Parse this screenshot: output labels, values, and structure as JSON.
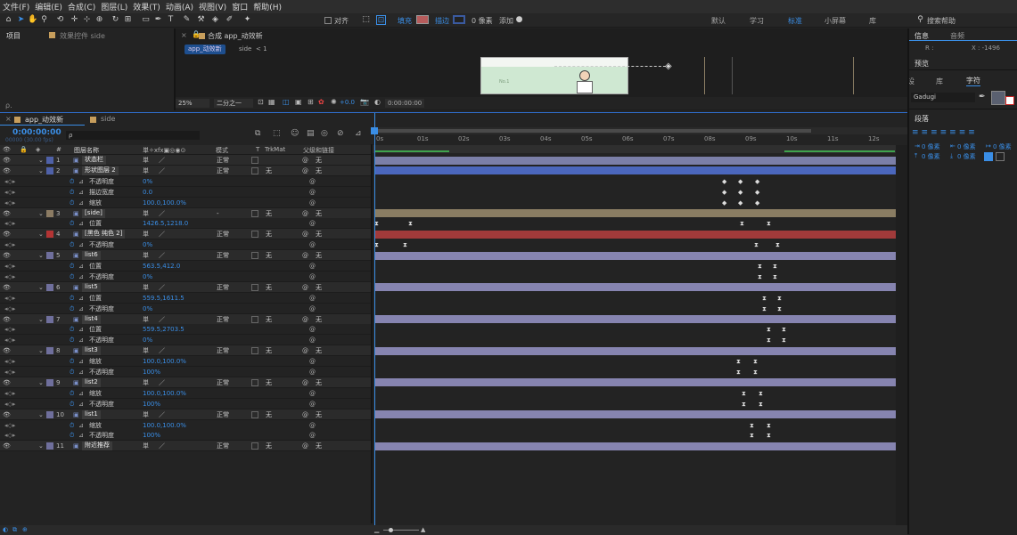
{
  "menu": [
    "文件(F)",
    "编辑(E)",
    "合成(C)",
    "图层(L)",
    "效果(T)",
    "动画(A)",
    "视图(V)",
    "窗口",
    "帮助(H)"
  ],
  "toolbar": {
    "align_label": "对齐",
    "fill_label": "填充",
    "stroke_label": "描边",
    "stroke_px": "0 像素",
    "add_label": "添加",
    "workspaces": [
      "默认",
      "学习",
      "标准",
      "小屏幕",
      "库"
    ],
    "active_workspace": "标准",
    "search_help": "搜索帮助"
  },
  "project": {
    "tab": "项目",
    "effects_tab": "效果控件 side"
  },
  "comp_viewer": {
    "tab": "合成 app_动效新",
    "crumb1": "app_动效新",
    "crumb2": "side",
    "crumb_sep": "< 1",
    "zoom": "25%",
    "resolution": "二分之一",
    "exposure": "+0.0",
    "timecode": "0:00:00:00"
  },
  "right_panel": {
    "info_tab": "信息",
    "audio_tab": "音频",
    "r_label": "R :",
    "x_label": "X : -1496",
    "preview_tab": "预览",
    "effects_tab": "设",
    "library_tab": "库",
    "character_tab": "字符",
    "font": "Gadugi",
    "paragraph_tab": "段落",
    "px_values": [
      "0 像素",
      "0 像素",
      "0 像素",
      "0 像素",
      "0 像素"
    ]
  },
  "timeline": {
    "tabs": [
      "app_动效新",
      "side"
    ],
    "timecode": "0:00:00:00",
    "frame_info": "00000 (30.00 fps)",
    "search_placeholder": "ρ",
    "headers": {
      "num": "#",
      "name": "图层名称",
      "mode": "模式",
      "t": "T",
      "trkmat": "TrkMat",
      "parent": "父级和链接"
    },
    "ruler": [
      "0s",
      "01s",
      "02s",
      "03s",
      "04s",
      "05s",
      "06s",
      "07s",
      "08s",
      "09s",
      "10s",
      "11s",
      "12s"
    ],
    "layers": [
      {
        "num": "1",
        "name": "状态栏",
        "mode": "正常",
        "trk": "",
        "parent": "无",
        "label": "#4f61a8",
        "bar": "#7b7fa8",
        "is_layer": true
      },
      {
        "num": "2",
        "name": "形状图层 2",
        "mode": "正常",
        "trk": "无",
        "parent": "无",
        "label": "#4f61a8",
        "bar": "#4b67bd",
        "is_layer": true
      },
      {
        "prop": "不透明度",
        "val": "0%"
      },
      {
        "prop": "描边宽度",
        "val": "0.0"
      },
      {
        "prop": "缩放",
        "val": "100.0,100.0%"
      },
      {
        "num": "3",
        "name": "[side]",
        "mode": "-",
        "trk": "无",
        "parent": "无",
        "label": "#8b7b63",
        "bar": "#8a7d63",
        "is_layer": true
      },
      {
        "prop": "位置",
        "val": "1426.5,1218.0"
      },
      {
        "num": "4",
        "name": "[黑色 纯色 2]",
        "mode": "正常",
        "trk": "无",
        "parent": "无",
        "label": "#b33434",
        "bar": "#a13a3a",
        "is_layer": true
      },
      {
        "prop": "不透明度",
        "val": "0%"
      },
      {
        "num": "5",
        "name": "list6",
        "mode": "正常",
        "trk": "无",
        "parent": "无",
        "label": "#6f6f9c",
        "bar": "#8684b0",
        "is_layer": true
      },
      {
        "prop": "位置",
        "val": "563.5,412.0"
      },
      {
        "prop": "不透明度",
        "val": "0%"
      },
      {
        "num": "6",
        "name": "list5",
        "mode": "正常",
        "trk": "无",
        "parent": "无",
        "label": "#6f6f9c",
        "bar": "#8684b0",
        "is_layer": true
      },
      {
        "prop": "位置",
        "val": "559.5,1611.5"
      },
      {
        "prop": "不透明度",
        "val": "0%"
      },
      {
        "num": "7",
        "name": "list4",
        "mode": "正常",
        "trk": "无",
        "parent": "无",
        "label": "#6f6f9c",
        "bar": "#8684b0",
        "is_layer": true
      },
      {
        "prop": "位置",
        "val": "559.5,2703.5"
      },
      {
        "prop": "不透明度",
        "val": "0%"
      },
      {
        "num": "8",
        "name": "list3",
        "mode": "正常",
        "trk": "无",
        "parent": "无",
        "label": "#6f6f9c",
        "bar": "#8684b0",
        "is_layer": true
      },
      {
        "prop": "缩放",
        "val": "100.0,100.0%"
      },
      {
        "prop": "不透明度",
        "val": "100%"
      },
      {
        "num": "9",
        "name": "list2",
        "mode": "正常",
        "trk": "无",
        "parent": "无",
        "label": "#6f6f9c",
        "bar": "#8684b0",
        "is_layer": true
      },
      {
        "prop": "缩放",
        "val": "100.0,100.0%"
      },
      {
        "prop": "不透明度",
        "val": "100%"
      },
      {
        "num": "10",
        "name": "list1",
        "mode": "正常",
        "trk": "无",
        "parent": "无",
        "label": "#6f6f9c",
        "bar": "#8684b0",
        "is_layer": true
      },
      {
        "prop": "缩放",
        "val": "100.0,100.0%"
      },
      {
        "prop": "不透明度",
        "val": "100%"
      },
      {
        "num": "11",
        "name": "附近推荐",
        "mode": "正常",
        "trk": "无",
        "parent": "无",
        "label": "#6f6f9c",
        "bar": "#8684b0",
        "is_layer": true
      }
    ],
    "keyframe_glyph": "◆",
    "hourglass_glyph": "⧗"
  },
  "colors": {
    "accent": "#2f6fd0",
    "keyframe_blue": "#3a8ee6"
  }
}
